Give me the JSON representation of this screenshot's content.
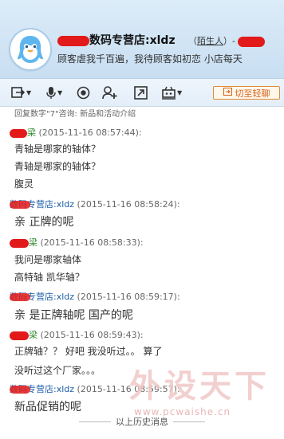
{
  "contact": {
    "name": "数码专营店:xldz",
    "tag_prefix": "（",
    "tag": "陌生人",
    "tag_suffix": "）-",
    "signature": "顾客虐我千百遍，我待顾客如初恋  小店每天"
  },
  "toolbar": {
    "switch_label": "切至轻聊"
  },
  "messages": {
    "hint": "回复数字\"7\"咨询: 新品和活动介绍",
    "items": [
      {
        "sender": "梁",
        "time": "(2015-11-16 08:57:44):",
        "lines": [
          "青轴是哪家的轴体？",
          "青轴是哪家的轴体？",
          "腹灵"
        ]
      },
      {
        "sender": "数码专营店:xldz",
        "time": "(2015-11-16 08:58:24):",
        "lines": [
          "亲 正牌的呢"
        ]
      },
      {
        "sender": "梁",
        "time": "(2015-11-16 08:58:33):",
        "lines": [
          "我问是哪家轴体",
          "高特轴 凯华轴？"
        ]
      },
      {
        "sender": "数码专营店:xldz",
        "time": "(2015-11-16 08:59:17):",
        "lines": [
          "亲 是正牌轴呢 国产的呢"
        ]
      },
      {
        "sender": "梁",
        "time": "(2015-11-16 08:59:43):",
        "lines": [
          "正牌轴？？ 好吧  我没听过。。  算了",
          "没听过这个厂家。。。"
        ]
      },
      {
        "sender": "数码专营店:xldz",
        "time": "(2015-11-16 08:59:57):",
        "lines": [
          "新品促销的呢"
        ]
      }
    ],
    "history_label": "以上历史消息"
  },
  "watermark": {
    "text": "外设天下",
    "url": "www.pcwaishe.cn"
  },
  "icons": {
    "avatar": "qq-penguin-avatar-icon",
    "transfer": "transfer-icon",
    "mic": "microphone-icon",
    "video": "video-camera-icon",
    "add_contact": "add-contact-icon",
    "share": "share-icon",
    "remote": "remote-assist-icon"
  },
  "colors": {
    "redact": "#e21a1a",
    "self_sender": "#1e5ea8",
    "other_sender": "#2f8a2f",
    "switch_border": "#e08a3c"
  }
}
